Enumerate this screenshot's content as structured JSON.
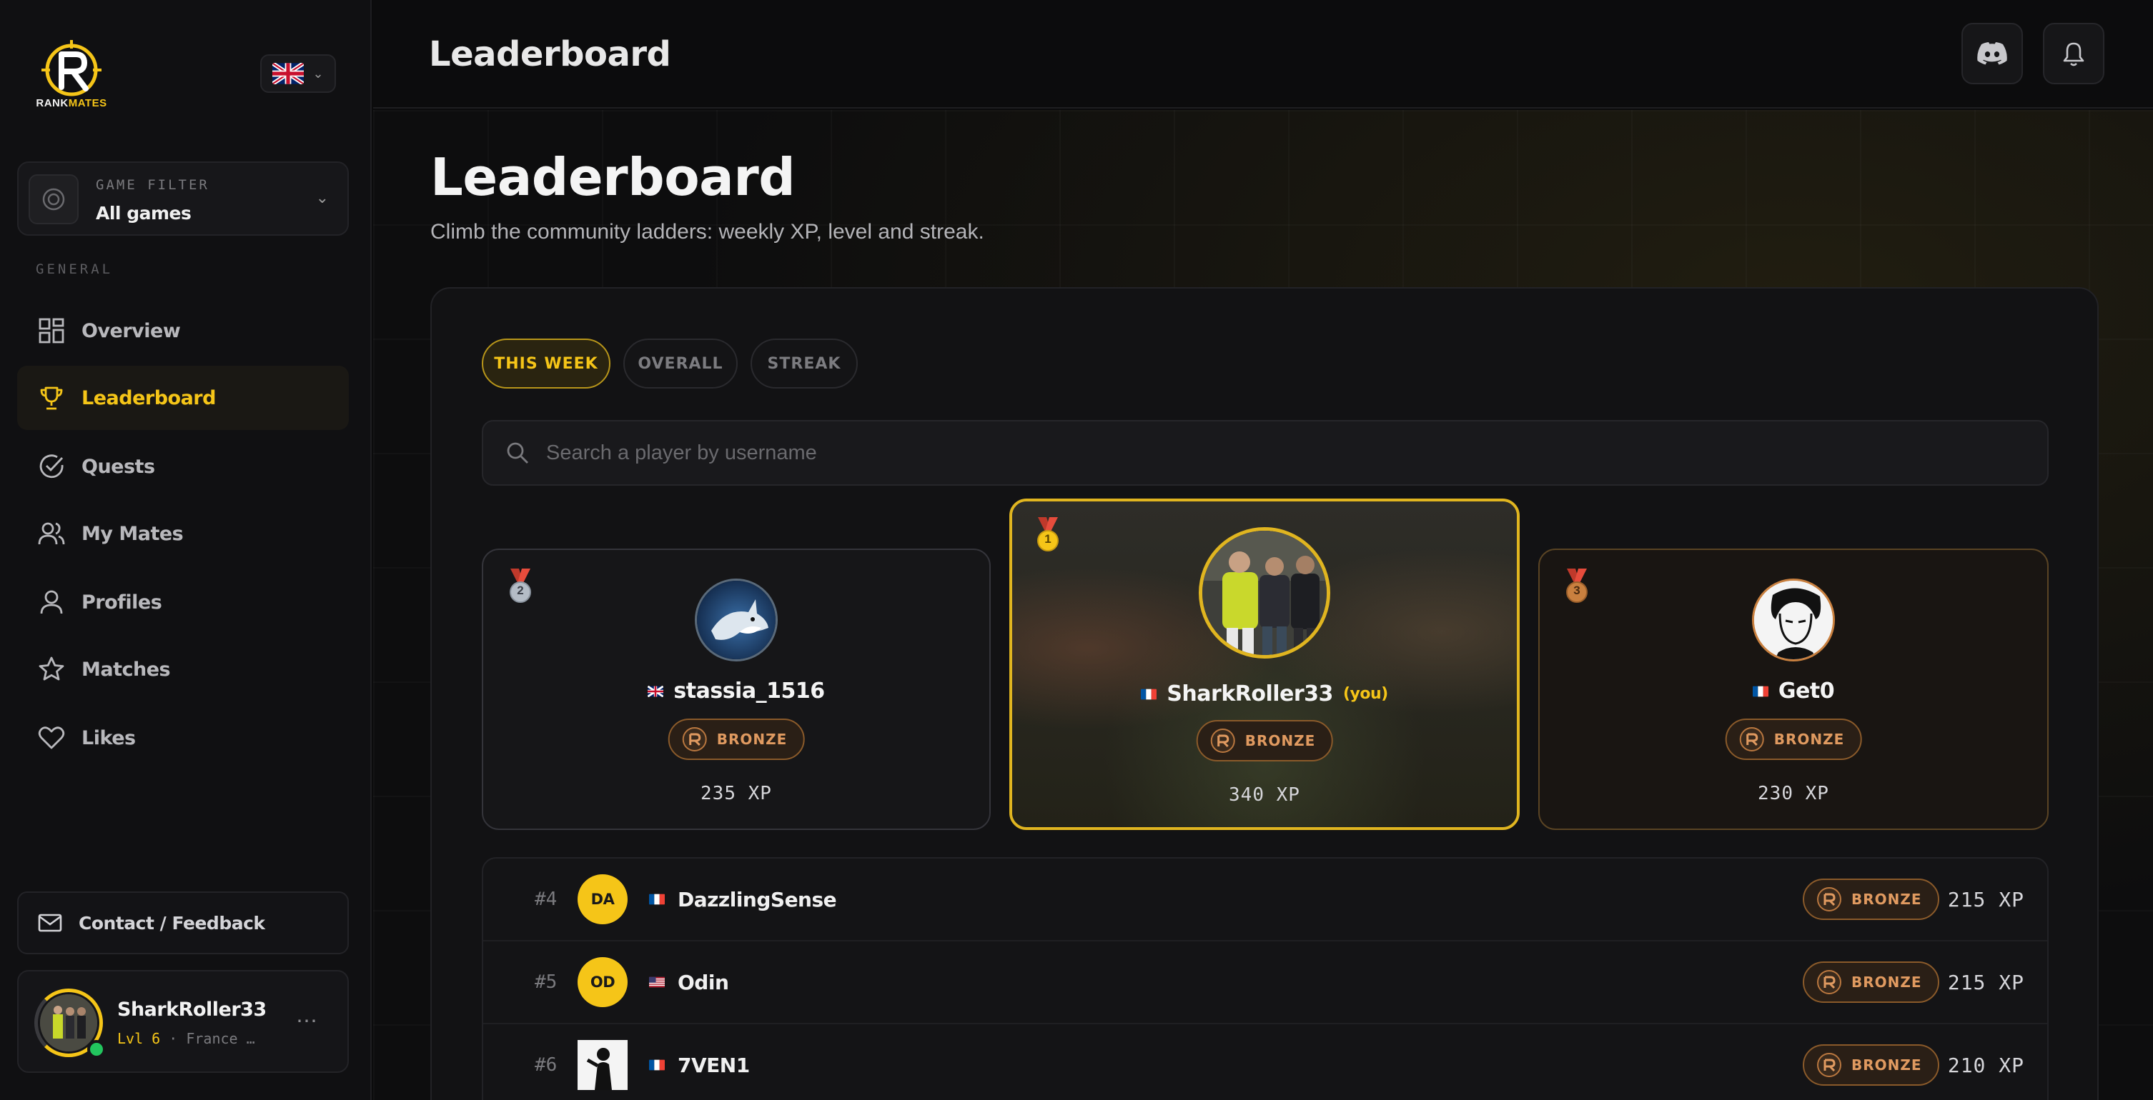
{
  "brand": {
    "name_part1": "RANK",
    "name_part2": "MATES"
  },
  "sidebar": {
    "game_filter": {
      "label": "GAME FILTER",
      "value": "All games"
    },
    "section_label": "GENERAL",
    "items": [
      {
        "label": "Overview",
        "icon": "overview-grid-icon"
      },
      {
        "label": "Leaderboard",
        "icon": "trophy-icon",
        "active": true
      },
      {
        "label": "Quests",
        "icon": "check-circle-icon"
      },
      {
        "label": "My Mates",
        "icon": "users-icon"
      },
      {
        "label": "Profiles",
        "icon": "user-icon"
      },
      {
        "label": "Matches",
        "icon": "star-icon"
      },
      {
        "label": "Likes",
        "icon": "heart-icon"
      }
    ],
    "contact_label": "Contact / Feedback",
    "user": {
      "name": "SharkRoller33",
      "level": "Lvl 6",
      "meta": "· France …"
    }
  },
  "topbar": {
    "title": "Leaderboard"
  },
  "page": {
    "title": "Leaderboard",
    "subtitle": "Climb the community ladders: weekly XP, level and streak."
  },
  "tabs": [
    {
      "label": "THIS WEEK",
      "active": true
    },
    {
      "label": "OVERALL"
    },
    {
      "label": "STREAK"
    }
  ],
  "search": {
    "placeholder": "Search a player by username"
  },
  "podium": {
    "first": {
      "place": "1",
      "name": "SharkRoller33",
      "you_label": "(you)",
      "rank": "BRONZE",
      "xp": "340 XP"
    },
    "second": {
      "place": "2",
      "name": "stassia_1516",
      "rank": "BRONZE",
      "xp": "235 XP"
    },
    "third": {
      "place": "3",
      "name": "Get0",
      "rank": "BRONZE",
      "xp": "230 XP"
    }
  },
  "rows": [
    {
      "rank": "#4",
      "initials": "DA",
      "flag": "fr",
      "name": "DazzlingSense",
      "badge": "BRONZE",
      "xp": "215 XP"
    },
    {
      "rank": "#5",
      "initials": "OD",
      "flag": "us",
      "name": "Odin",
      "badge": "BRONZE",
      "xp": "215 XP"
    },
    {
      "rank": "#6",
      "initials": "",
      "flag": "fr",
      "name": "7VEN1",
      "badge": "BRONZE",
      "xp": "210 XP"
    }
  ],
  "colors": {
    "accent": "#f5c518",
    "bronze": "#e09a60",
    "background": "#0b0b0c"
  }
}
